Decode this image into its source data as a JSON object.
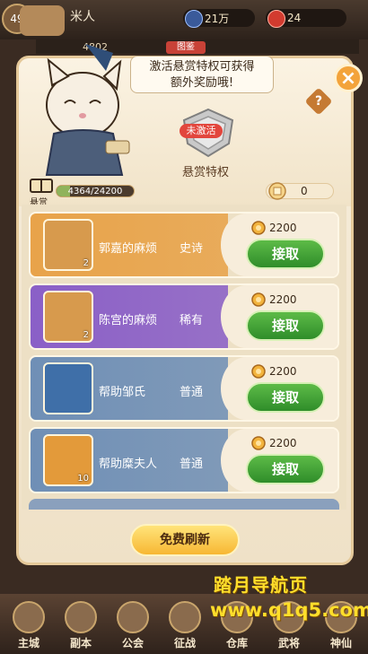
{
  "topbar": {
    "level": "49",
    "player_name": "米人",
    "silver": "21万",
    "gold": "24",
    "power_partial": "4802",
    "sub_tag": "图鉴"
  },
  "panel": {
    "bubble_text_line1": "激活悬赏特权可获得",
    "bubble_text_line2": "额外奖励哦!",
    "close_icon": "×",
    "help_icon": "?",
    "privilege": {
      "status": "未激活",
      "label": "悬赏特权",
      "count": "0"
    },
    "bounty": {
      "label": "悬赏",
      "progress_text": "4364/24200",
      "progress_fraction": 0.18
    }
  },
  "quests": [
    {
      "name": "郭嘉的麻烦",
      "rarity": "史诗",
      "count": "2",
      "reward": "2200",
      "button": "接取",
      "color": "#e8a34a",
      "icon": "scroll-icon"
    },
    {
      "name": "陈宫的麻烦",
      "rarity": "稀有",
      "count": "2",
      "reward": "2200",
      "button": "接取",
      "color": "#8a5fc7",
      "icon": "scroll-icon"
    },
    {
      "name": "帮助邹氏",
      "rarity": "普通",
      "count": "",
      "reward": "2200",
      "button": "接取",
      "color": "#6f8fb6",
      "icon": "crystal-icon"
    },
    {
      "name": "帮助糜夫人",
      "rarity": "普通",
      "count": "10",
      "reward": "2200",
      "button": "接取",
      "color": "#6f8fb6",
      "icon": "gold-ingot-icon"
    }
  ],
  "refresh_button": "免费刷新",
  "nav": [
    "主城",
    "副本",
    "公会",
    "征战",
    "仓库",
    "武将",
    "神仙"
  ],
  "watermark": {
    "line1": "踏月导航页",
    "line2": "www.q1q5.com"
  }
}
